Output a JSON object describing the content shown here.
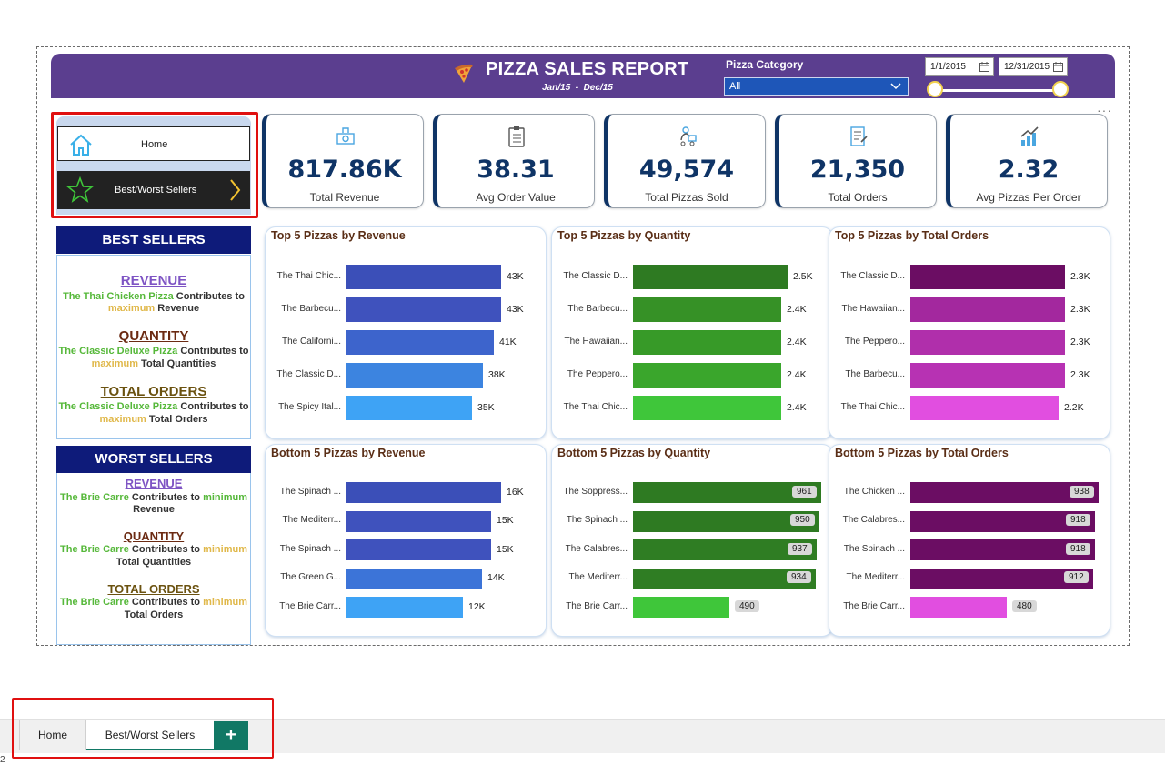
{
  "header": {
    "title": "PIZZA SALES REPORT",
    "subtitle": "Jan/15  -  Dec/15",
    "filter_label": "Pizza Category",
    "filter_value": "All",
    "date_start": "1/1/2015",
    "date_end": "12/31/2015"
  },
  "nav": {
    "home_label": "Home",
    "best_label": "Best/Worst Sellers"
  },
  "kpis": [
    {
      "value": "817.86K",
      "label": "Total Revenue",
      "icon": "money-icon"
    },
    {
      "value": "38.31",
      "label": "Avg Order Value",
      "icon": "clipboard-icon"
    },
    {
      "value": "49,574",
      "label": "Total Pizzas Sold",
      "icon": "delivery-icon"
    },
    {
      "value": "21,350",
      "label": "Total Orders",
      "icon": "order-list-icon"
    },
    {
      "value": "2.32",
      "label": "Avg Pizzas Per Order",
      "icon": "growth-chart-icon"
    }
  ],
  "best_sellers": {
    "heading": "BEST SELLERS",
    "revenue_title": "REVENUE",
    "revenue_pizza": "The Thai Chicken Pizza",
    "revenue_text1": " Contributes to",
    "revenue_max": "maximum",
    "revenue_text2": " Revenue",
    "quantity_title": "QUANTITY",
    "quantity_pizza": "The Classic Deluxe Pizza",
    "quantity_text1": " Contributes to",
    "quantity_max": "maximum",
    "quantity_text2": " Total Quantities",
    "orders_title": "TOTAL ORDERS",
    "orders_pizza": "The Classic Deluxe Pizza",
    "orders_text1": " Contributes to",
    "orders_max": "maximum",
    "orders_text2": " Total Orders"
  },
  "worst_sellers": {
    "heading": "WORST SELLERS",
    "revenue_title": "REVENUE",
    "revenue_pizza": "The Brie Carre",
    "revenue_text1": " Contributes to ",
    "revenue_min": "minimum",
    "revenue_text2": "Revenue",
    "quantity_title": "QUANTITY",
    "quantity_pizza": "The Brie Carre",
    "quantity_text1": " Contributes to ",
    "quantity_min": "minimum",
    "quantity_text2": "Total Quantities",
    "orders_title": "TOTAL ORDERS",
    "orders_pizza": "The Brie Carre",
    "orders_text1": " Contributes to ",
    "orders_min": "minimum",
    "orders_text2": "Total Orders"
  },
  "tabs": {
    "home": "Home",
    "best": "Best/Worst Sellers",
    "add": "+"
  },
  "page_number": "2",
  "chart_data": [
    {
      "type": "bar",
      "title": "Top 5 Pizzas by Revenue",
      "categories": [
        "The Thai Chic...",
        "The Barbecu...",
        "The Californi...",
        "The Classic D...",
        "The Spicy Ital..."
      ],
      "values": [
        43,
        43,
        41,
        38,
        35
      ],
      "labels": [
        "43K",
        "43K",
        "41K",
        "38K",
        "35K"
      ],
      "colors": [
        "#3b4fb8",
        "#3f52bd",
        "#3d64cc",
        "#3c84e0",
        "#3ea3f5"
      ]
    },
    {
      "type": "bar",
      "title": "Top 5 Pizzas by Quantity",
      "categories": [
        "The Classic D...",
        "The Barbecu...",
        "The Hawaiian...",
        "The Peppero...",
        "The Thai Chic..."
      ],
      "values": [
        2.5,
        2.4,
        2.4,
        2.4,
        2.4
      ],
      "labels": [
        "2.5K",
        "2.4K",
        "2.4K",
        "2.4K",
        "2.4K"
      ],
      "colors": [
        "#2e7a22",
        "#369126",
        "#379a28",
        "#3aa62c",
        "#3fc63a"
      ]
    },
    {
      "type": "bar",
      "title": "Top 5 Pizzas by Total Orders",
      "categories": [
        "The Classic D...",
        "The Hawaiian...",
        "The Peppero...",
        "The Barbecu...",
        "The Thai Chic..."
      ],
      "values": [
        2.3,
        2.3,
        2.3,
        2.3,
        2.2
      ],
      "labels": [
        "2.3K",
        "2.3K",
        "2.3K",
        "2.3K",
        "2.2K"
      ],
      "colors": [
        "#6b0d63",
        "#a3289e",
        "#b02fab",
        "#b732b3",
        "#e14ee0"
      ]
    },
    {
      "type": "bar",
      "title": "Bottom 5 Pizzas by Revenue",
      "categories": [
        "The Spinach ...",
        "The Mediterr...",
        "The Spinach ...",
        "The Green G...",
        "The Brie Carr..."
      ],
      "values": [
        16,
        15,
        15,
        14,
        12
      ],
      "labels": [
        "16K",
        "15K",
        "15K",
        "14K",
        "12K"
      ],
      "colors": [
        "#3b4fb8",
        "#3f52bd",
        "#3f52bd",
        "#3c74d8",
        "#3ea3f5"
      ]
    },
    {
      "type": "bar",
      "title": "Bottom 5 Pizzas by Quantity",
      "categories": [
        "The Soppress...",
        "The Spinach ...",
        "The Calabres...",
        "The Mediterr...",
        "The Brie Carr..."
      ],
      "values": [
        961,
        950,
        937,
        934,
        490
      ],
      "labels": [
        "961",
        "950",
        "937",
        "934",
        "490"
      ],
      "colors": [
        "#2e7a22",
        "#2e7a22",
        "#2f7d23",
        "#2f7d23",
        "#3fc63a"
      ]
    },
    {
      "type": "bar",
      "title": "Bottom 5 Pizzas by Total Orders",
      "categories": [
        "The Chicken ...",
        "The Calabres...",
        "The Spinach ...",
        "The Mediterr...",
        "The Brie Carr..."
      ],
      "values": [
        938,
        918,
        918,
        912,
        480
      ],
      "labels": [
        "938",
        "918",
        "918",
        "912",
        "480"
      ],
      "colors": [
        "#6b0d63",
        "#6b0d63",
        "#6b0d63",
        "#6b0d63",
        "#e14ee0"
      ]
    }
  ]
}
